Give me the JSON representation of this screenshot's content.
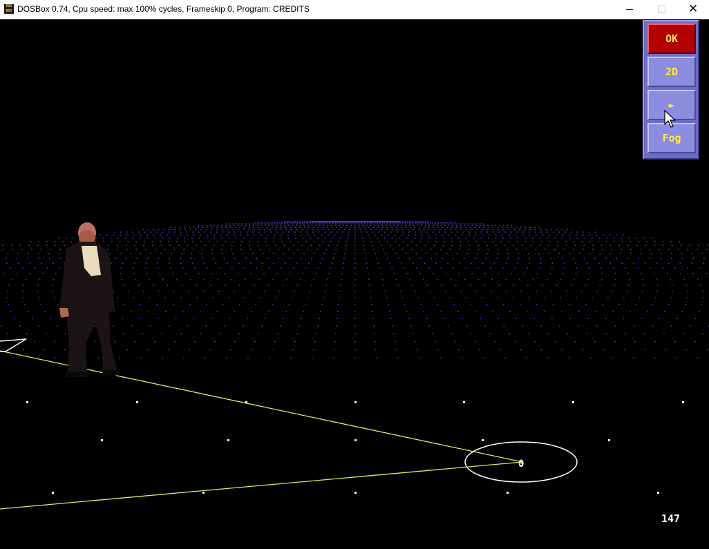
{
  "window": {
    "title": "DOSBox 0.74, Cpu speed: max 100% cycles, Frameskip  0, Program:  CREDITS",
    "icon_text": [
      "DOS",
      "BOX"
    ]
  },
  "panel": {
    "ok_label": "OK",
    "view_label": "2D",
    "play_label": "►",
    "fog_label": "Fog"
  },
  "scene": {
    "marker_label": "0",
    "counter": "147"
  },
  "colors": {
    "grid_dots": "#4040c0",
    "path_line": "#e8e860",
    "ellipse": "#ffffff",
    "panel_bg": "#6c6cc8",
    "ok_button": "#b30000",
    "button_text": "#ffe84a"
  }
}
